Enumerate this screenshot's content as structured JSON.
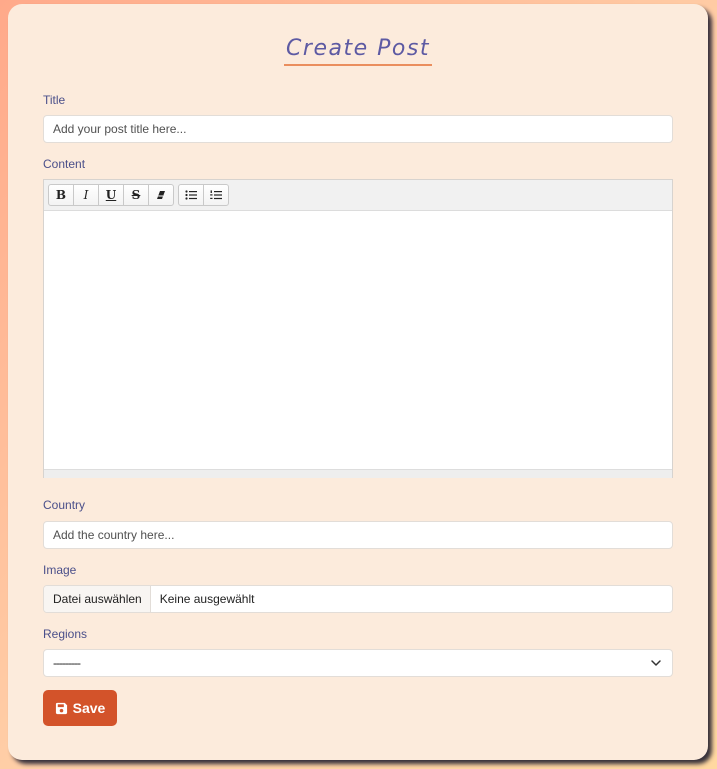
{
  "form": {
    "heading": "Create Post",
    "title_label": "Title",
    "title_placeholder": "Add your post title here...",
    "title_value": "",
    "content_label": "Content",
    "content_value": "",
    "toolbar": {
      "bold": "B",
      "italic": "I",
      "underline": "U",
      "strikethrough": "S",
      "icons": [
        "bold",
        "italic",
        "underline",
        "strikethrough",
        "eraser-icon",
        "bulleted-list-icon",
        "numbered-list-icon"
      ]
    },
    "country_label": "Country",
    "country_placeholder": "Add the country here...",
    "country_value": "",
    "image_label": "Image",
    "file_button": "Datei auswählen",
    "file_status": "Keine ausgewählt",
    "regions_label": "Regions",
    "regions_selected": "---------",
    "save_label": "Save"
  },
  "colors": {
    "heading": "#5d5aa3",
    "heading_underline": "#ea8e5e",
    "label": "#4a4f8a",
    "card": "#fcebdc",
    "save_button": "#d3532a"
  }
}
